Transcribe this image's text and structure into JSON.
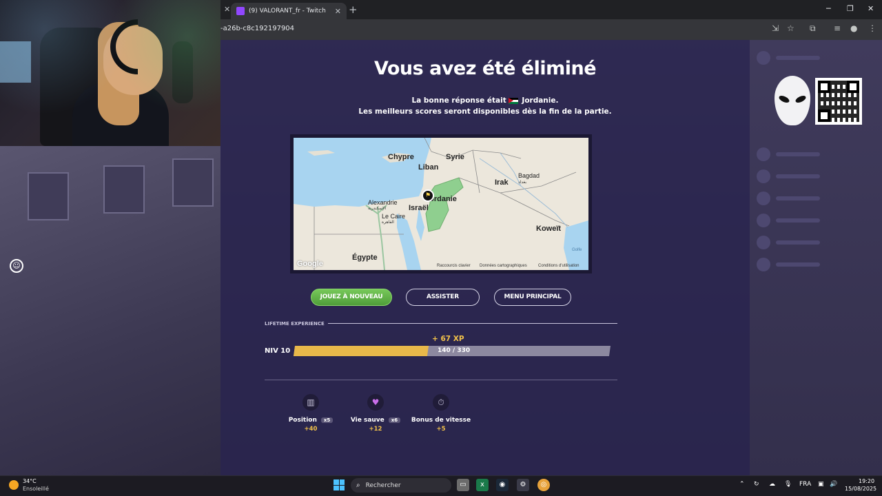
{
  "browser": {
    "tab_title": "(9) VALORANT_fr - Twitch",
    "url_fragment": "-a26b-c8c192197904",
    "tab_close": "✕",
    "new_tab": "+"
  },
  "game": {
    "title": "Vous avez été éliminé",
    "answer_prefix": "La bonne réponse était",
    "answer_country": "Jordanie",
    "answer_suffix": ".",
    "scores_notice": "Les meilleurs scores seront disponibles dès la fin de la partie.",
    "map": {
      "labels": {
        "chypre": "Chypre",
        "liban": "Liban",
        "syrie": "Syrie",
        "irak": "Irak",
        "bagdad": "Bagdad",
        "bagdad_ar": "بغداد",
        "alexandrie": "Alexandrie",
        "alexandrie_ar": "الإسكندرية",
        "israel": "Israël",
        "jordanie": "Jordanie",
        "le_caire": "Le Caire",
        "le_caire_ar": "القاهرة",
        "koweit": "Koweït",
        "egypte": "Égypte",
        "golfe": "Golfe",
        "google": "Google",
        "shortcuts": "Raccourcis clavier",
        "map_data": "Données cartographiques",
        "terms": "Conditions d'utilisation"
      },
      "colors": {
        "land": "#ece7dc",
        "sea": "#a8d4f0",
        "highlight": "#8fcf8f"
      }
    },
    "buttons": {
      "play_again": "JOUEZ À NOUVEAU",
      "watch": "ASSISTER",
      "main_menu": "MENU PRINCIPAL"
    },
    "xp": {
      "section_label": "LIFETIME EXPERIENCE",
      "gain": "+ 67 XP",
      "level": "NIV 10",
      "progress_text": "140 / 330",
      "progress_fraction": 0.424
    },
    "bonuses": [
      {
        "label": "Position",
        "mult": "x5",
        "value": "+40",
        "icon": "trophy-icon"
      },
      {
        "label": "Vie sauve",
        "mult": "x6",
        "value": "+12",
        "icon": "heart-icon"
      },
      {
        "label": "Bonus de vitesse",
        "mult": "",
        "value": "+5",
        "icon": "speed-icon"
      }
    ]
  },
  "taskbar": {
    "weather_temp": "34°C",
    "weather_desc": "Ensoleillé",
    "search_placeholder": "Rechercher",
    "language": "FRA",
    "time": "19:20",
    "date": "15/08/2025"
  }
}
